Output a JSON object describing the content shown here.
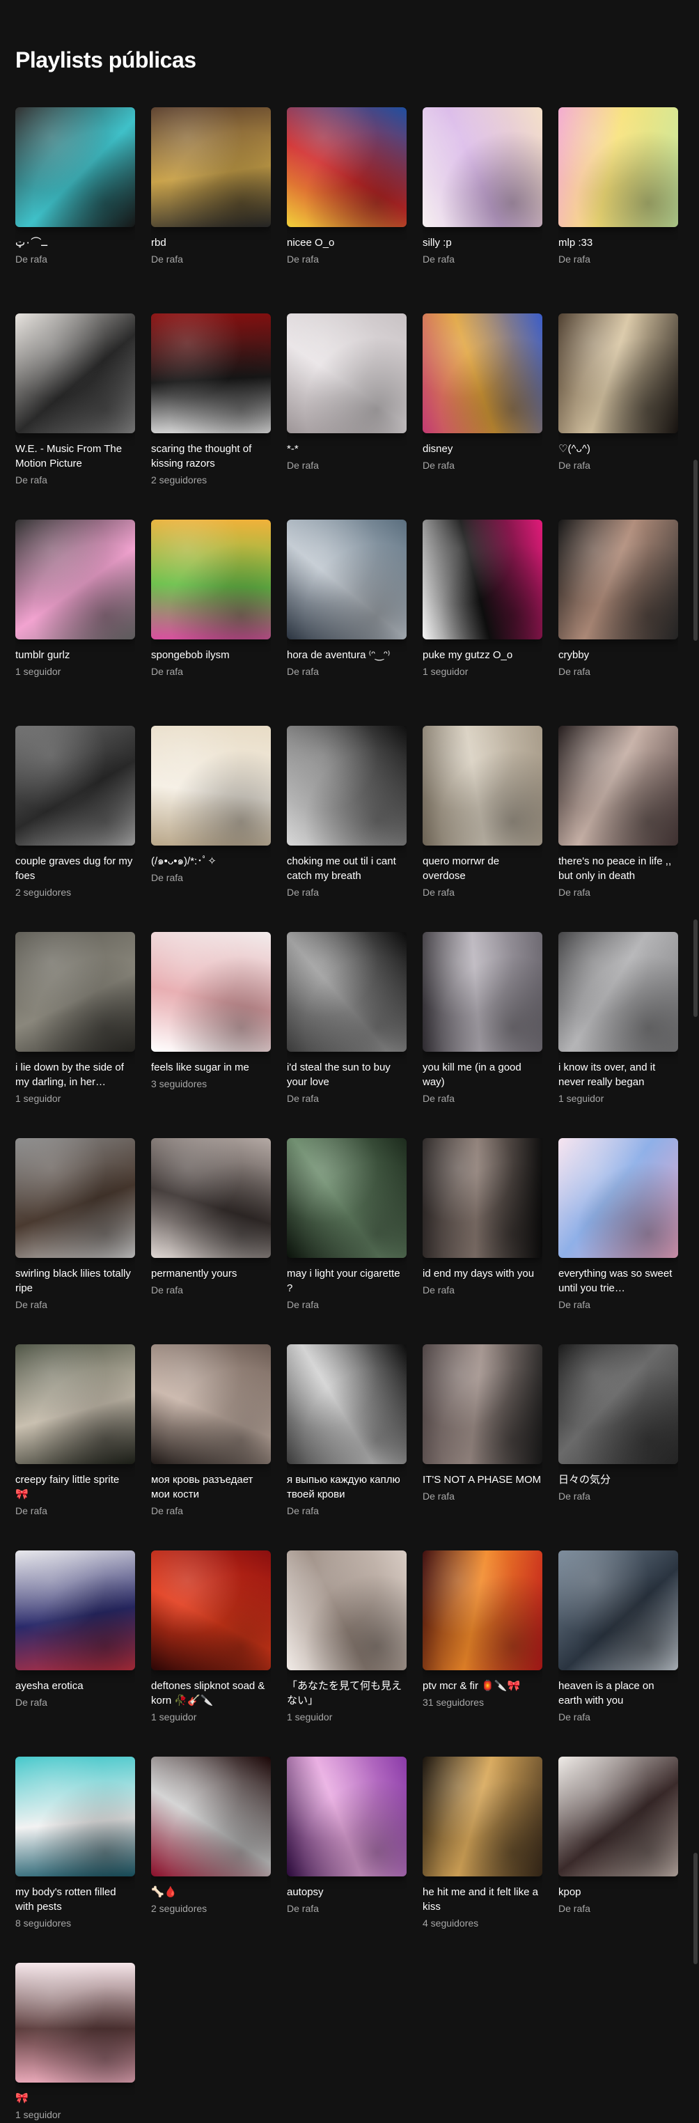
{
  "page": {
    "title": "Playlists públicas"
  },
  "playlists": [
    {
      "name": "ــ⌒٠ټ",
      "subtitle": "De rafa",
      "colors": [
        "#2a2a2a",
        "#3fc1c9",
        "#1a1a1a"
      ]
    },
    {
      "name": "rbd",
      "subtitle": "De rafa",
      "colors": [
        "#5a3e2b",
        "#c9a24a",
        "#2b2b2b"
      ]
    },
    {
      "name": "nicee O_o",
      "subtitle": "De rafa",
      "colors": [
        "#1f4fa0",
        "#d12c2c",
        "#f2d13b"
      ]
    },
    {
      "name": "silly :p",
      "subtitle": "De rafa",
      "colors": [
        "#f4e0c8",
        "#d9b7e8",
        "#f6f0f0"
      ]
    },
    {
      "name": "mlp :33",
      "subtitle": "De rafa",
      "colors": [
        "#c9e9a0",
        "#f7e27a",
        "#f3a9d0"
      ]
    },
    {
      "name": "W.E. - Music From The Motion Picture",
      "subtitle": "De rafa",
      "colors": [
        "#e8e4df",
        "#2a2a2a",
        "#8c8c8c"
      ]
    },
    {
      "name": "scaring the thought of kissing razors",
      "subtitle": "2 seguidores",
      "colors": [
        "#8b0f0f",
        "#1a1a1a",
        "#e6e6e6"
      ]
    },
    {
      "name": "*-*",
      "subtitle": "De rafa",
      "colors": [
        "#c8c2c4",
        "#e9e4e6",
        "#9d9597"
      ]
    },
    {
      "name": "disney",
      "subtitle": "De rafa",
      "colors": [
        "#3b5dc9",
        "#e0a23a",
        "#c23a73"
      ]
    },
    {
      "name": "♡(^ᴗ^)",
      "subtitle": "De rafa",
      "colors": [
        "#1a1512",
        "#d9c7a5",
        "#4a3a2a"
      ]
    },
    {
      "name": "tumblr gurlz",
      "subtitle": "1 seguidor",
      "colors": [
        "#2b2b2b",
        "#f2a3d0",
        "#6e6e6e"
      ]
    },
    {
      "name": "spongebob ilysm",
      "subtitle": "De rafa",
      "colors": [
        "#f2b13a",
        "#6bc04a",
        "#d94fa0"
      ]
    },
    {
      "name": "hora de aventura ⁽ᵔ‿ᵔ⁾",
      "subtitle": "De rafa",
      "colors": [
        "#5a6e7e",
        "#c0c8d0",
        "#2b3440"
      ]
    },
    {
      "name": "puke my gutzz O_o",
      "subtitle": "1 seguidor",
      "colors": [
        "#e21b7a",
        "#111111",
        "#f7f7f7"
      ]
    },
    {
      "name": "crybby",
      "subtitle": "De rafa",
      "colors": [
        "#2a2a2a",
        "#b08c7a",
        "#0f0f0f"
      ]
    },
    {
      "name": "couple graves dug for my foes",
      "subtitle": "2 seguidores",
      "colors": [
        "#6e6e6e",
        "#2a2a2a",
        "#b5b5b5"
      ]
    },
    {
      "name": "(/๑•ᴗ•๑)/*:･ﾟ✧",
      "subtitle": "De rafa",
      "colors": [
        "#e8dcc6",
        "#f5efe4",
        "#b9a78a"
      ]
    },
    {
      "name": "choking me out til i cant catch my breath",
      "subtitle": "De rafa",
      "colors": [
        "#0f0f0f",
        "#8a8a8a",
        "#d8d8d8"
      ]
    },
    {
      "name": "quero morrwr de overdose",
      "subtitle": "De rafa",
      "colors": [
        "#a89c8a",
        "#d8cfbf",
        "#6b6254"
      ]
    },
    {
      "name": "there's no peace in life ,, but only in death",
      "subtitle": "De rafa",
      "colors": [
        "#4a3a3a",
        "#c6b0a6",
        "#1e1616"
      ]
    },
    {
      "name": "i lie down by the side of my darling, in her…",
      "subtitle": "1 seguidor",
      "colors": [
        "#5c5a52",
        "#8a877c",
        "#2a2925"
      ]
    },
    {
      "name": "feels like sugar in me",
      "subtitle": "3 seguidores",
      "colors": [
        "#f2ecec",
        "#e7a9ad",
        "#ffffff"
      ]
    },
    {
      "name": "i'd steal the sun to buy your love",
      "subtitle": "De rafa",
      "colors": [
        "#0b0b0b",
        "#9a9a9a",
        "#3a3a3a"
      ]
    },
    {
      "name": "you kill me (in a good way)",
      "subtitle": "De rafa",
      "colors": [
        "#6e6a72",
        "#b9b4bc",
        "#2e2b30"
      ]
    },
    {
      "name": "i know its over, and it never really began",
      "subtitle": "1 seguidor",
      "colors": [
        "#7a7a7c",
        "#b5b5b7",
        "#3e3e40"
      ]
    },
    {
      "name": "swirling black lilies totally ripe",
      "subtitle": "De rafa",
      "colors": [
        "#8a8a8a",
        "#4a3a30",
        "#d8d8d8"
      ]
    },
    {
      "name": "permanently yours",
      "subtitle": "De rafa",
      "colors": [
        "#b5aaa5",
        "#3a3230",
        "#e0d8d4"
      ]
    },
    {
      "name": "may i light your cigarette ?",
      "subtitle": "De rafa",
      "colors": [
        "#1c2a1c",
        "#6a8a6a",
        "#0b120b"
      ]
    },
    {
      "name": "id end my days with you",
      "subtitle": "De rafa",
      "colors": [
        "#0c0c0c",
        "#8a7a72",
        "#2a2524"
      ]
    },
    {
      "name": "everything was so sweet until you trie…",
      "subtitle": "De rafa",
      "colors": [
        "#f0a8c6",
        "#8fb0e8",
        "#f8e4ef"
      ]
    },
    {
      "name": "creepy fairy little sprite 🎀",
      "subtitle": "De rafa",
      "colors": [
        "#4a5040",
        "#c9c0b0",
        "#1f221a"
      ]
    },
    {
      "name": "моя кровь разъедает мои кости",
      "subtitle": "De rafa",
      "colors": [
        "#6a5a52",
        "#c8b4a8",
        "#201a18"
      ]
    },
    {
      "name": "я выпью каждую каплю твоей крови",
      "subtitle": "De rafa",
      "colors": [
        "#0c0c0c",
        "#d0d0d0",
        "#3a3a3a"
      ]
    },
    {
      "name": "IT'S NOT A PHASE MOM",
      "subtitle": "De rafa",
      "colors": [
        "#1a1a1a",
        "#a0908a",
        "#4a4040"
      ]
    },
    {
      "name": "日々の気分",
      "subtitle": "De rafa",
      "colors": [
        "#2a2a2a",
        "#6a6a6a",
        "#141414"
      ]
    },
    {
      "name": "ayesha erotica",
      "subtitle": "De rafa",
      "colors": [
        "#e8e8ec",
        "#2a2a6a",
        "#c03040"
      ]
    },
    {
      "name": "deftones slipknot soad & korn 🥀🎸🔪",
      "subtitle": "1 seguidor",
      "colors": [
        "#8a0f0f",
        "#e23a1a",
        "#2a0606"
      ]
    },
    {
      "name": "「あなたを見て何も見えない」",
      "subtitle": "1 seguidor",
      "colors": [
        "#d8ccc4",
        "#9a8a80",
        "#f2ece8"
      ]
    },
    {
      "name": "ptv mcr & fir 🏮🔪🎀",
      "subtitle": "31 seguidores",
      "colors": [
        "#c01a1a",
        "#f28a2a",
        "#3a0808"
      ]
    },
    {
      "name": "heaven is a place on earth with you",
      "subtitle": "De rafa",
      "colors": [
        "#7a8a9a",
        "#2a3440",
        "#c8d0d8"
      ]
    },
    {
      "name": "my body's rotten filled with pests",
      "subtitle": "8 seguidores",
      "colors": [
        "#3fc6c9",
        "#f2f2f2",
        "#1a5a6a"
      ]
    },
    {
      "name": "🦴🩸",
      "subtitle": "2 seguidores",
      "colors": [
        "#1a0606",
        "#d0d0d0",
        "#8a0f2a"
      ]
    },
    {
      "name": "autopsy",
      "subtitle": "De rafa",
      "colors": [
        "#8a3aa8",
        "#e8a8e0",
        "#2a0a3a"
      ]
    },
    {
      "name": "he hit me and it felt like a kiss",
      "subtitle": "4 seguidores",
      "colors": [
        "#3a2a1a",
        "#d8a85a",
        "#120c06"
      ]
    },
    {
      "name": "kpop",
      "subtitle": "De rafa",
      "colors": [
        "#f0ece8",
        "#3a2a2a",
        "#c8b8b0"
      ]
    },
    {
      "name": "🎀",
      "subtitle": "1 seguidor",
      "colors": [
        "#f6e6ea",
        "#5a3a3a",
        "#e8a8b8"
      ]
    }
  ],
  "scrollbar_color": "#3a3a3a"
}
